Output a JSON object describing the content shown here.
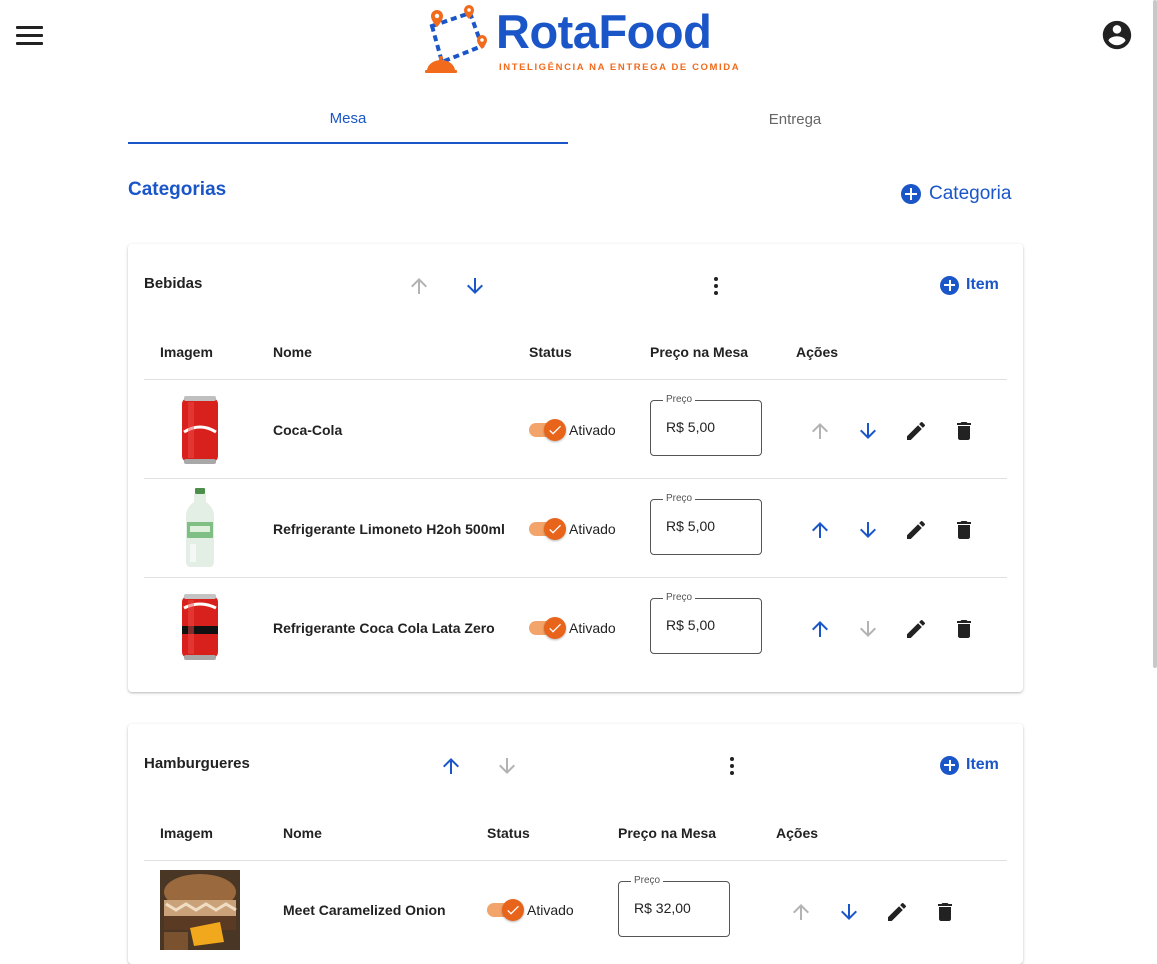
{
  "brand": {
    "name": "RotaFood",
    "tagline": "INTELIGÊNCIA NA ENTREGA DE COMIDA",
    "primary_color": "#1a56c8",
    "accent_color": "#f26a1b"
  },
  "header": {
    "menu_icon": "menu-icon",
    "account_icon": "account-circle-icon"
  },
  "tabs": [
    {
      "label": "Mesa",
      "active": true
    },
    {
      "label": "Entrega",
      "active": false
    }
  ],
  "categories_section": {
    "title": "Categorias",
    "add_label": "Categoria"
  },
  "table_headers": {
    "image": "Imagem",
    "name": "Nome",
    "status": "Status",
    "price": "Preço na Mesa",
    "actions": "Ações"
  },
  "categories": [
    {
      "name": "Bebidas",
      "add_item_label": "Item",
      "move_up_enabled": false,
      "move_down_enabled": true,
      "items": [
        {
          "name": "Coca-Cola",
          "status": "Ativado",
          "price_label": "Preço",
          "price": "R$ 5,00",
          "up_enabled": false,
          "down_enabled": true
        },
        {
          "name": "Refrigerante Limoneto H2oh 500ml",
          "status": "Ativado",
          "price_label": "Preço",
          "price": "R$ 5,00",
          "up_enabled": true,
          "down_enabled": true
        },
        {
          "name": "Refrigerante Coca Cola Lata Zero",
          "status": "Ativado",
          "price_label": "Preço",
          "price": "R$ 5,00",
          "up_enabled": true,
          "down_enabled": false
        }
      ]
    },
    {
      "name": "Hamburgueres",
      "add_item_label": "Item",
      "move_up_enabled": true,
      "move_down_enabled": false,
      "items": [
        {
          "name": "Meet Caramelized Onion",
          "status": "Ativado",
          "price_label": "Preço",
          "price": "R$ 32,00",
          "up_enabled": false,
          "down_enabled": true
        }
      ]
    }
  ]
}
